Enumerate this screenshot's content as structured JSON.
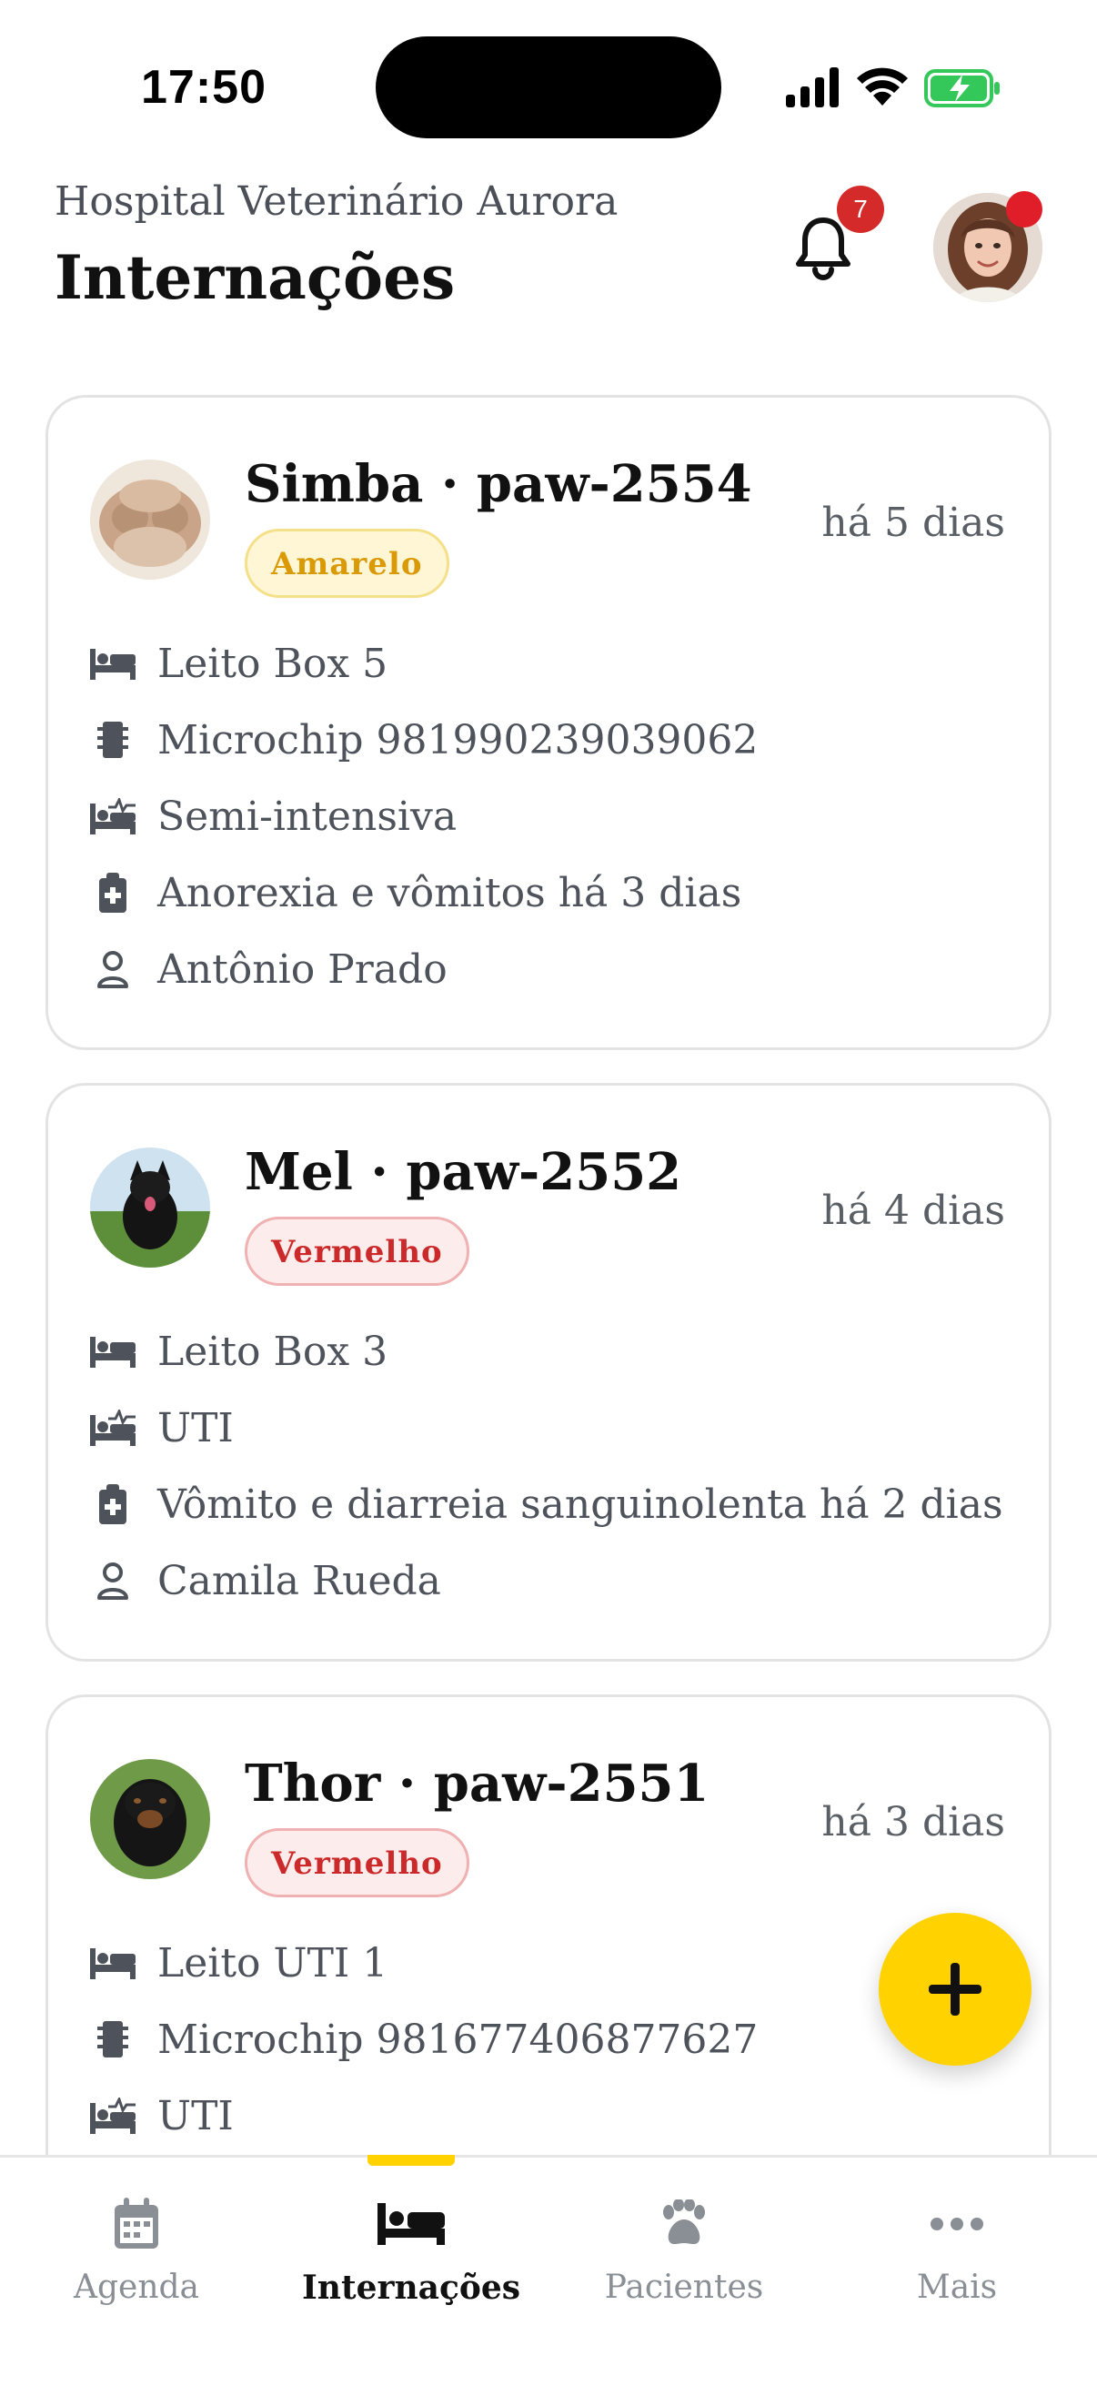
{
  "status_bar": {
    "time": "17:50"
  },
  "header": {
    "hospital_name": "Hospital Veterinário Aurora",
    "title": "Internações",
    "notification_count": "7"
  },
  "cards": [
    {
      "title": "Simba · paw-2554",
      "badge": "Amarelo",
      "ago": "há 5 dias",
      "rows": {
        "bed": "Leito Box 5",
        "microchip": "Microchip 981990239039062",
        "care": "Semi-intensiva",
        "complaint": "Anorexia e vômitos há 3 dias",
        "owner": "Antônio Prado"
      }
    },
    {
      "title": "Mel · paw-2552",
      "badge": "Vermelho",
      "ago": "há 4 dias",
      "rows": {
        "bed": "Leito Box 3",
        "care": "UTI",
        "complaint": "Vômito e diarreia sanguinolenta há 2 dias",
        "owner": "Camila Rueda"
      }
    },
    {
      "title": "Thor · paw-2551",
      "badge": "Vermelho",
      "ago": "há 3 dias",
      "rows": {
        "bed": "Leito UTI 1",
        "microchip": "Microchip 981677406877627",
        "care": "UTI"
      }
    }
  ],
  "tabbar": {
    "tabs": [
      {
        "label": "Agenda",
        "icon": "calendar-icon"
      },
      {
        "label": "Internações",
        "icon": "bed-icon",
        "active": true
      },
      {
        "label": "Pacientes",
        "icon": "paw-icon"
      },
      {
        "label": "Mais",
        "icon": "more-icon"
      }
    ]
  },
  "colors": {
    "accent": "#ffd200",
    "badge_amarelo": "#d99a06",
    "badge_vermelho": "#cc2a2a",
    "notification": "#d42a2a"
  }
}
